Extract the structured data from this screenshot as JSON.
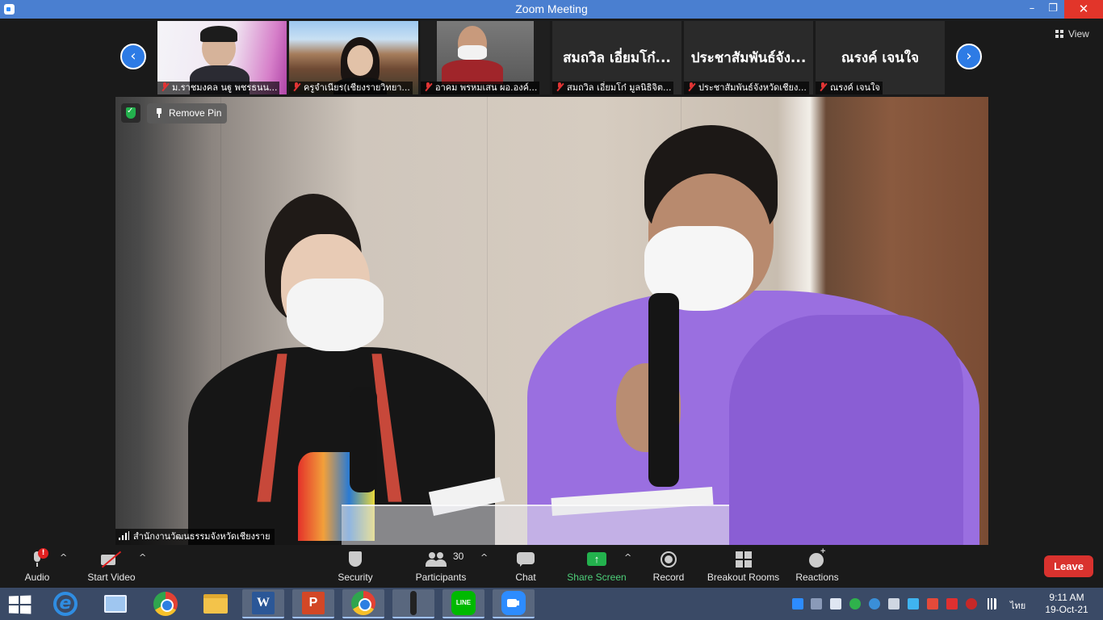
{
  "window": {
    "title": "Zoom Meeting",
    "controls": {
      "minimize": "–",
      "maximize": "❐",
      "close": "✕"
    }
  },
  "gallery": {
    "prev_label": "‹",
    "next_label": "›",
    "view_label": "View",
    "participants": [
      {
        "name": "ม.ราชมงคล นฐู พชรธนน...",
        "muted": true,
        "video": true
      },
      {
        "name": "ครูจำเนียร(เชียงรายวิทยา...",
        "muted": true,
        "video": true
      },
      {
        "name": "อาคม พรหมเสน ผอ.องค์...",
        "muted": true,
        "video": true
      },
      {
        "name": "สมถวิล  เอี่ยมโก๋ มูลนิธิจิต...",
        "big_name": "สมถวิล  เอี่ยมโก๋...",
        "muted": true,
        "video": false
      },
      {
        "name": "ประชาสัมพันธ์จังหวัดเชียง...",
        "big_name": "ประชาสัมพันธ์จัง...",
        "muted": true,
        "video": false
      },
      {
        "name": "ณรงค์ เจนใจ",
        "big_name": "ณรงค์ เจนใจ",
        "muted": true,
        "video": false
      }
    ]
  },
  "main_video": {
    "remove_pin_label": "Remove Pin",
    "speaker_name": "สำนักงานวัฒนธรรมจังหวัดเชียงราย"
  },
  "toolbar": {
    "audio": "Audio",
    "audio_alert": "!",
    "start_video": "Start Video",
    "security": "Security",
    "participants": "Participants",
    "participants_count": "30",
    "chat": "Chat",
    "share_screen": "Share Screen",
    "record": "Record",
    "breakout_rooms": "Breakout Rooms",
    "reactions": "Reactions",
    "leave": "Leave",
    "caret": "^"
  },
  "taskbar": {
    "apps": [
      "internet-explorer",
      "desktop-manager",
      "chrome",
      "file-explorer",
      "word",
      "powerpoint",
      "chrome-profile",
      "microphone-app",
      "line",
      "zoom"
    ],
    "word_letter": "W",
    "ppt_letter": "P",
    "ie_letter": "e",
    "line_label": "LINE",
    "language": "ไทย",
    "time": "9:11 AM",
    "date": "19-Oct-21"
  },
  "colors": {
    "title_bar": "#4a7fd0",
    "leave": "#d9322e",
    "share_green": "#23b14d",
    "nav_blue": "#2d7be5"
  }
}
